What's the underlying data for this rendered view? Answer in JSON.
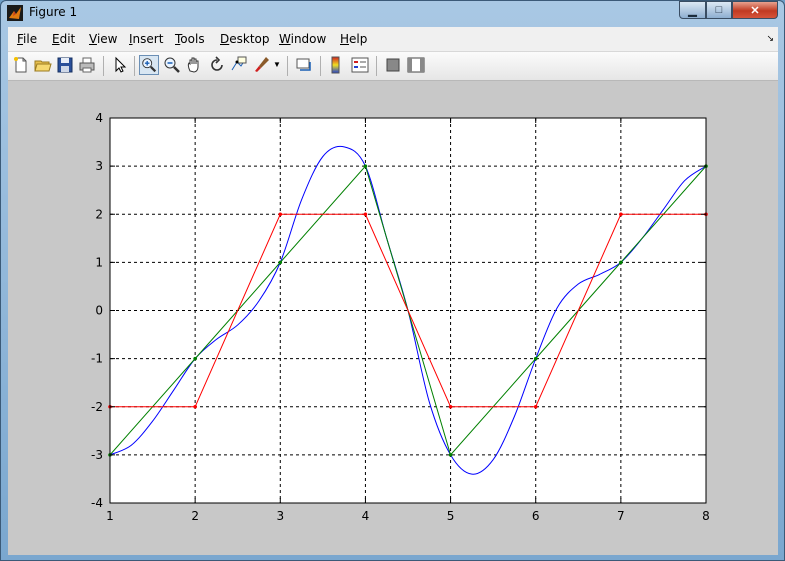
{
  "window": {
    "title": "Figure 1",
    "buttons": [
      "minimize",
      "maximize",
      "close"
    ]
  },
  "menu": {
    "items": [
      {
        "label": "File",
        "mnemonic": "F",
        "rest": "ile"
      },
      {
        "label": "Edit",
        "mnemonic": "E",
        "rest": "dit"
      },
      {
        "label": "View",
        "mnemonic": "V",
        "rest": "iew"
      },
      {
        "label": "Insert",
        "mnemonic": "I",
        "rest": "nsert"
      },
      {
        "label": "Tools",
        "mnemonic": "T",
        "rest": "ools"
      },
      {
        "label": "Desktop",
        "mnemonic": "D",
        "rest": "esktop"
      },
      {
        "label": "Window",
        "mnemonic": "W",
        "rest": "indow"
      },
      {
        "label": "Help",
        "mnemonic": "H",
        "rest": "elp"
      }
    ],
    "dock_arrow": "↘"
  },
  "toolbar": {
    "buttons": [
      "new-figure-icon",
      "open-file-icon",
      "save-icon",
      "print-icon",
      "edit-plot-icon",
      "zoom-in-icon",
      "zoom-out-icon",
      "pan-icon",
      "rotate-3d-icon",
      "data-cursor-icon",
      "brush-icon",
      "brush-dropdown-icon",
      "link-plot-icon",
      "colorbar-icon",
      "legend-icon",
      "hide-plot-tools-icon",
      "show-plot-tools-icon"
    ],
    "pressed": "zoom-in-icon"
  },
  "chart_data": {
    "type": "line",
    "xlim": [
      1,
      8
    ],
    "ylim": [
      -4,
      4
    ],
    "xticks": [
      1,
      2,
      3,
      4,
      5,
      6,
      7,
      8
    ],
    "yticks": [
      -4,
      -3,
      -2,
      -1,
      0,
      1,
      2,
      3,
      4
    ],
    "grid": true,
    "grid_style": "dashed",
    "series": [
      {
        "color": "#0000ff",
        "style": "smooth-spline",
        "x": [
          1,
          1.25,
          1.5,
          1.75,
          2,
          2.25,
          2.5,
          2.75,
          3,
          3.25,
          3.5,
          3.75,
          4,
          4.25,
          4.5,
          4.75,
          5,
          5.25,
          5.5,
          5.75,
          6,
          6.25,
          6.5,
          6.75,
          7,
          7.25,
          7.5,
          7.75,
          8
        ],
        "y": [
          -3,
          -2.8,
          -2.3,
          -1.65,
          -1,
          -0.6,
          -0.3,
          0.2,
          1,
          2.3,
          3.2,
          3.4,
          3,
          1.5,
          0,
          -1.9,
          -3,
          -3.4,
          -3.1,
          -2.2,
          -1,
          0.05,
          0.55,
          0.75,
          1,
          1.5,
          2.1,
          2.7,
          3
        ]
      },
      {
        "color": "#008000",
        "style": "linear",
        "marker": "dot",
        "x": [
          1,
          2,
          3,
          4,
          5,
          6,
          7,
          8
        ],
        "y": [
          -3,
          -1,
          1,
          3,
          -3,
          -1,
          1,
          3
        ]
      },
      {
        "color": "#ff0000",
        "style": "linear",
        "marker": "dot",
        "x": [
          1,
          2,
          3,
          4,
          5,
          6,
          7,
          8
        ],
        "y": [
          -2,
          -2,
          2,
          2,
          -2,
          -2,
          2,
          2
        ]
      }
    ]
  }
}
